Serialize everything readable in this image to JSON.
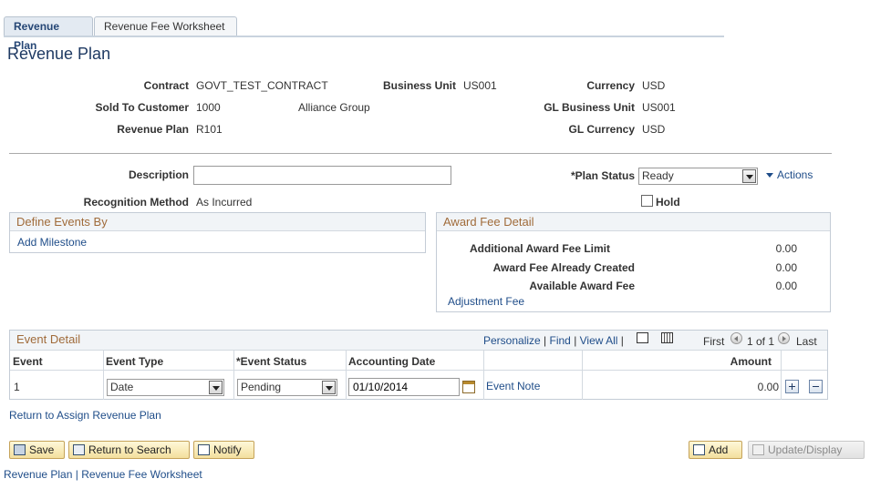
{
  "tabs": [
    {
      "label": "Revenue Plan"
    },
    {
      "label": "Revenue Fee Worksheet"
    }
  ],
  "page_title": "Revenue Plan",
  "header": {
    "contract_label": "Contract",
    "contract_value": "GOVT_TEST_CONTRACT",
    "business_unit_label": "Business Unit",
    "business_unit_value": "US001",
    "currency_label": "Currency",
    "currency_value": "USD",
    "sold_to_label": "Sold To Customer",
    "sold_to_value": "1000",
    "sold_to_name": "Alliance Group",
    "gl_bu_label": "GL Business Unit",
    "gl_bu_value": "US001",
    "revenue_plan_label": "Revenue Plan",
    "revenue_plan_value": "R101",
    "gl_currency_label": "GL Currency",
    "gl_currency_value": "USD"
  },
  "form": {
    "description_label": "Description",
    "description_value": "",
    "plan_status_label": "*Plan Status",
    "plan_status_value": "Ready",
    "actions_label": "Actions",
    "recognition_label": "Recognition Method",
    "recognition_value": "As Incurred",
    "hold_label": "Hold"
  },
  "define_events": {
    "title": "Define Events By",
    "add_milestone": "Add Milestone"
  },
  "award_fee": {
    "title": "Award Fee Detail",
    "rows": [
      {
        "label": "Additional Award Fee Limit",
        "value": "0.00"
      },
      {
        "label": "Award Fee Already Created",
        "value": "0.00"
      },
      {
        "label": "Available Award Fee",
        "value": "0.00"
      }
    ],
    "adjustment_link": "Adjustment Fee"
  },
  "event_detail": {
    "title": "Event Detail",
    "personalize": "Personalize",
    "find": "Find",
    "view_all": "View All",
    "first": "First",
    "pager": "1 of 1",
    "last": "Last",
    "columns": [
      "Event",
      "Event Type",
      "*Event Status",
      "Accounting Date",
      "Amount"
    ],
    "row": {
      "event": "1",
      "event_type": "Date",
      "event_status": "Pending",
      "accounting_date": "01/10/2014",
      "event_note": "Event Note",
      "amount": "0.00"
    }
  },
  "return_link": "Return to Assign Revenue Plan",
  "toolbar": {
    "save": "Save",
    "return_to_search": "Return to Search",
    "notify": "Notify",
    "add": "Add",
    "update_display": "Update/Display"
  },
  "footer_links": {
    "revenue_plan": "Revenue Plan",
    "separator": "|",
    "revenue_fee_worksheet": "Revenue Fee Worksheet"
  }
}
